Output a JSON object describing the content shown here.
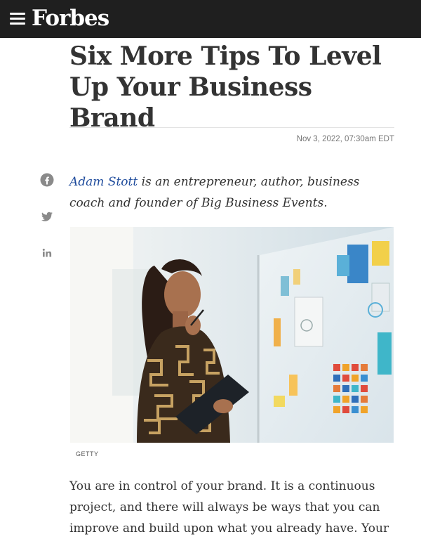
{
  "header": {
    "logo": "Forbes",
    "menu_icon": "hamburger-menu-icon"
  },
  "article": {
    "title": "Six More Tips To Level Up Your Business Brand",
    "date": "Nov 3, 2022, 07:30am EDT",
    "author_name": "Adam Stott",
    "author_bio": " is an entrepreneur, author, business coach and founder of Big Business Events.",
    "image_credit": "GETTY",
    "body_paragraph": "You are in control of your brand. It is a continuous project, and there will always be ways that you can improve and build upon what you already have. Your"
  },
  "share": {
    "icons": [
      "facebook-icon",
      "twitter-icon",
      "linkedin-icon"
    ]
  },
  "colors": {
    "header_bg": "#1f1f1f",
    "title": "#333333",
    "link": "#1e4b9c",
    "share_icon": "#8a8a8a"
  }
}
